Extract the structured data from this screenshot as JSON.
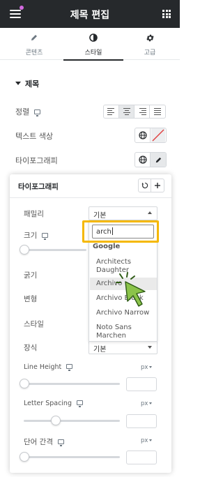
{
  "header": {
    "title": "제목 편집"
  },
  "tabs": [
    {
      "label": "콘텐츠",
      "icon": "pencil-icon"
    },
    {
      "label": "스타일",
      "icon": "half-circle-icon",
      "active": true
    },
    {
      "label": "고급",
      "icon": "gear-icon"
    }
  ],
  "section": {
    "title": "제목"
  },
  "controls": {
    "alignment_label": "정렬",
    "text_color_label": "텍스트 색상",
    "typography_label": "타이포그래피"
  },
  "popover": {
    "title": "타이포그래피",
    "family_label": "패밀리",
    "family_value": "기본",
    "size_label": "크기",
    "weight_label": "굵기",
    "transform_label": "변형",
    "style_label": "스타일",
    "decoration_label": "장식",
    "decoration_value": "기본",
    "line_height_label": "Line Height",
    "line_height_unit": "px",
    "letter_spacing_label": "Letter Spacing",
    "letter_spacing_unit": "px",
    "word_spacing_label": "단어 간격",
    "word_spacing_unit": "px"
  },
  "dropdown": {
    "search_value": "arch",
    "group": "Google",
    "options": [
      "Architects Daughter",
      "Archivo",
      "Archivo Black",
      "Archivo Narrow",
      "Noto Sans Marchen"
    ],
    "hovered_option": "Archivo"
  },
  "colors": {
    "header_bg": "#26292c",
    "highlight": "#f5b800",
    "cursor": "#8bc34a"
  }
}
